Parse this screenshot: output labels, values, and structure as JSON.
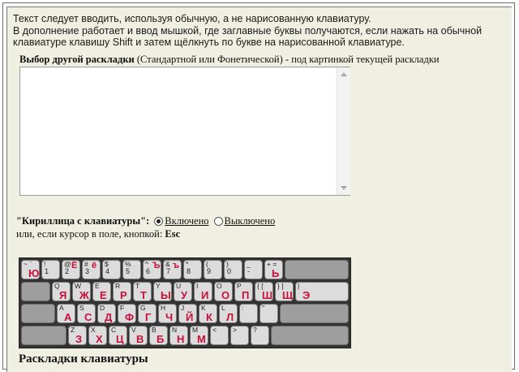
{
  "intro": {
    "line1": "Текст следует вводить, используя обычную, а не нарисованную клавиатуру.",
    "line2": "В дополнение работает и ввод мышкой, где заглавные буквы получаются, если нажать на обычной",
    "line3": "клавиатуре клавишу Shift и затем щёлкнуть по букве на нарисованной клавиатуре."
  },
  "layout_hint": {
    "bold": "Выбор другой раскладки",
    "rest": " (Стандартной или Фонетической) - под картинкой текущей раскладки"
  },
  "text_area": {
    "value": ""
  },
  "cyrillic_toggle": {
    "label": "\"Кириллица с клавиатуры\":",
    "on_label": "Включено",
    "off_label": "Выключено",
    "selected": "on"
  },
  "esc_hint": {
    "text": "или, если курсор в поле, кнопкой: ",
    "key": "Esc"
  },
  "keyboard": {
    "row1": [
      {
        "lat": "~ `",
        "cyr": "Ю"
      },
      {
        "lat": "!",
        "sub": "1",
        "cyr": ""
      },
      {
        "lat": "@",
        "sub": "2",
        "cyr": "Ё"
      },
      {
        "lat": "#",
        "sub": "3",
        "cyr": "ё"
      },
      {
        "lat": "$",
        "sub": "4",
        "cyr": ""
      },
      {
        "lat": "%",
        "sub": "5",
        "cyr": ""
      },
      {
        "lat": "^",
        "sub": "6",
        "cyr": "Ъ"
      },
      {
        "lat": "&",
        "sub": "7",
        "cyr": "ъ"
      },
      {
        "lat": "*",
        "sub": "8",
        "cyr": ""
      },
      {
        "lat": "(",
        "sub": "9",
        "cyr": ""
      },
      {
        "lat": ")",
        "sub": "0",
        "cyr": ""
      },
      {
        "lat": "_",
        "sub": "-",
        "cyr": ""
      },
      {
        "lat": "+ =",
        "cyr": "Ь"
      }
    ],
    "row2": [
      {
        "lat": "Q",
        "cyr": "Я"
      },
      {
        "lat": "W",
        "cyr": "Ж"
      },
      {
        "lat": "E",
        "cyr": "Е"
      },
      {
        "lat": "R",
        "cyr": "Р"
      },
      {
        "lat": "T",
        "cyr": "Т"
      },
      {
        "lat": "Y",
        "cyr": "Ы"
      },
      {
        "lat": "U",
        "cyr": "У"
      },
      {
        "lat": "I",
        "cyr": "И"
      },
      {
        "lat": "O",
        "cyr": "О"
      },
      {
        "lat": "P",
        "cyr": "П"
      },
      {
        "lat": "{ [",
        "cyr": "Ш"
      },
      {
        "lat": "} ]",
        "cyr": "Щ"
      },
      {
        "lat": "|",
        "cyr": "Э"
      }
    ],
    "row3": [
      {
        "lat": "A",
        "cyr": "А"
      },
      {
        "lat": "S",
        "cyr": "С"
      },
      {
        "lat": "D",
        "cyr": "Д"
      },
      {
        "lat": "F",
        "cyr": "Ф"
      },
      {
        "lat": "G",
        "cyr": "Г"
      },
      {
        "lat": "H",
        "cyr": "Ч"
      },
      {
        "lat": "J",
        "cyr": "Й"
      },
      {
        "lat": "K",
        "cyr": "К"
      },
      {
        "lat": "L",
        "cyr": "Л"
      },
      {
        "lat": ":",
        "cyr": ""
      },
      {
        "lat": "\"",
        "cyr": ""
      }
    ],
    "row4": [
      {
        "lat": "Z",
        "cyr": "З"
      },
      {
        "lat": "X",
        "cyr": "Х"
      },
      {
        "lat": "C",
        "cyr": "Ц"
      },
      {
        "lat": "V",
        "cyr": "В"
      },
      {
        "lat": "B",
        "cyr": "Б"
      },
      {
        "lat": "N",
        "cyr": "Н"
      },
      {
        "lat": "M",
        "cyr": "М"
      },
      {
        "lat": "<",
        "cyr": ""
      },
      {
        "lat": ">",
        "cyr": ""
      },
      {
        "lat": "?",
        "cyr": ""
      }
    ]
  },
  "section_title": "Раскладки клавиатуры"
}
